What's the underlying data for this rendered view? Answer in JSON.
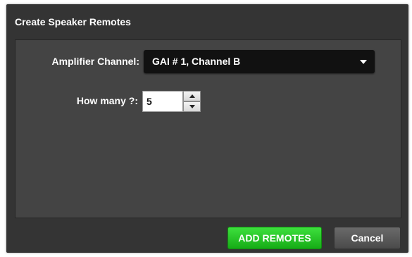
{
  "dialog": {
    "title": "Create Speaker Remotes"
  },
  "form": {
    "amplifier_channel": {
      "label": "Amplifier Channel:",
      "selected": "GAI # 1, Channel B"
    },
    "how_many": {
      "label": "How many ?:",
      "value": "5"
    }
  },
  "buttons": {
    "add_label": "ADD REMOTES",
    "cancel_label": "Cancel"
  },
  "icons": {
    "dropdown": "chevron-down-icon",
    "increment": "arrow-up-icon",
    "decrement": "arrow-down-icon"
  },
  "colors": {
    "dialog_bg": "#343434",
    "panel_bg": "#444444",
    "select_bg": "#111111",
    "add_button": "#22c322",
    "cancel_button": "#5a5a5a"
  }
}
